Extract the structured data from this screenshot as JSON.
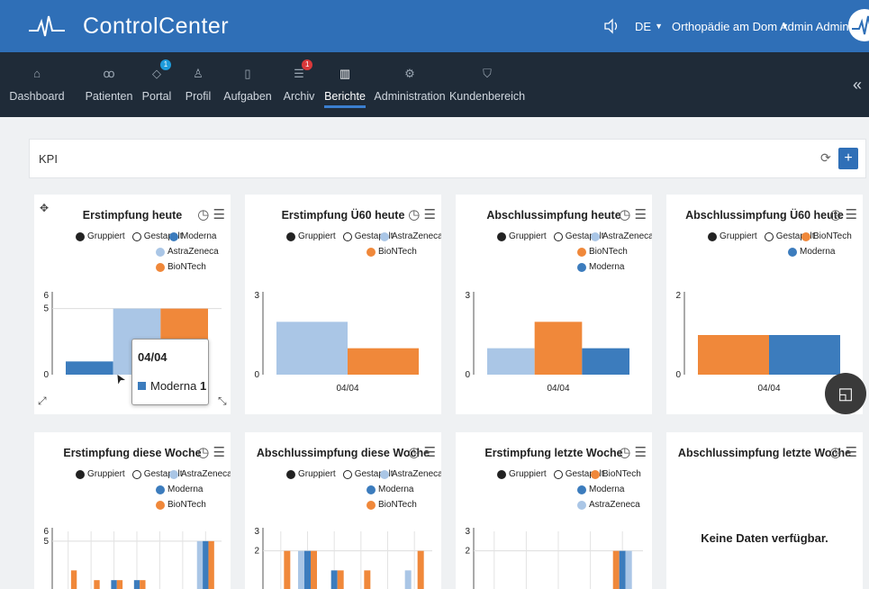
{
  "app": {
    "brand": "ControlCenter"
  },
  "topbar": {
    "language": "DE",
    "clinic": "Orthopädie am Dom",
    "user": "Admin Admin"
  },
  "nav": {
    "items": [
      {
        "label": "Dashboard",
        "icon": "home-icon"
      },
      {
        "label": "Patienten",
        "icon": "patients-icon"
      },
      {
        "label": "Portal",
        "icon": "portal-icon",
        "badge": "1"
      },
      {
        "label": "Profil",
        "icon": "profile-icon"
      },
      {
        "label": "Aufgaben",
        "icon": "tasks-icon"
      },
      {
        "label": "Archiv",
        "icon": "archive-icon",
        "badge": "1"
      },
      {
        "label": "Berichte",
        "icon": "reports-icon",
        "active": true
      },
      {
        "label": "Administration",
        "icon": "gear-icon"
      },
      {
        "label": "Kundenbereich",
        "icon": "cart-icon"
      }
    ]
  },
  "kpi": {
    "label": "KPI"
  },
  "legend_common": {
    "grouped": "Gruppiert",
    "stacked": "Gestapelt"
  },
  "colors": {
    "moderna": "#3c7cbd",
    "astrazeneca": "#aac6e6",
    "biontech": "#f0883a"
  },
  "cards": [
    {
      "title": "Erstimpfung heute",
      "legend": [
        "Moderna",
        "AstraZeneca",
        "BioNTech"
      ],
      "stacked_label": "Gestapelt",
      "tooltip": {
        "date": "04/04",
        "series": "Moderna",
        "value": "1"
      }
    },
    {
      "title": "Erstimpfung Ü60 heute",
      "legend": [
        "AstraZeneca",
        "BioNTech"
      ],
      "stacked_label": "Gestapelt",
      "xlabel": "04/04"
    },
    {
      "title": "Abschlussimpfung heute",
      "legend": [
        "AstraZeneca",
        "BioNTech",
        "Moderna"
      ],
      "stacked_label": "Gestapelt",
      "xlabel": "04/04"
    },
    {
      "title": "Abschlussimpfung Ü60 heute",
      "legend": [
        "BioNTech",
        "Moderna"
      ],
      "stacked_label": "Gestapelt",
      "xlabel": "04/04"
    },
    {
      "title": "Erstimpfung diese Woche",
      "legend": [
        "AstraZeneca",
        "Moderna",
        "BioNTech"
      ],
      "stacked_label": "Gestapelt"
    },
    {
      "title": "Abschlussimpfung diese Woche",
      "legend": [
        "AstraZeneca",
        "Moderna",
        "BioNTech"
      ],
      "stacked_label": "Gestapelt"
    },
    {
      "title": "Erstimpfung letzte Woche",
      "legend": [
        "BioNTech",
        "Moderna",
        "AstraZeneca"
      ],
      "stacked_label": "Gestapelt"
    },
    {
      "title": "Abschlussimpfung letzte Woche",
      "nodata": "Keine Daten verfügbar."
    }
  ],
  "chart_data": [
    {
      "type": "bar",
      "title": "Erstimpfung heute",
      "categories": [
        "04/04"
      ],
      "ylim": [
        0,
        6
      ],
      "yticks": [
        "0",
        "5",
        "6"
      ],
      "series": [
        {
          "name": "Moderna",
          "values": [
            1
          ]
        },
        {
          "name": "AstraZeneca",
          "values": [
            5
          ]
        },
        {
          "name": "BioNTech",
          "values": [
            5
          ]
        }
      ]
    },
    {
      "type": "bar",
      "title": "Erstimpfung Ü60 heute",
      "categories": [
        "04/04"
      ],
      "ylim": [
        0,
        3
      ],
      "yticks": [
        "0",
        "3"
      ],
      "series": [
        {
          "name": "AstraZeneca",
          "values": [
            2
          ]
        },
        {
          "name": "BioNTech",
          "values": [
            1
          ]
        }
      ]
    },
    {
      "type": "bar",
      "title": "Abschlussimpfung heute",
      "categories": [
        "04/04"
      ],
      "ylim": [
        0,
        3
      ],
      "yticks": [
        "0",
        "3"
      ],
      "series": [
        {
          "name": "AstraZeneca",
          "values": [
            1
          ]
        },
        {
          "name": "BioNTech",
          "values": [
            2
          ]
        },
        {
          "name": "Moderna",
          "values": [
            1
          ]
        }
      ]
    },
    {
      "type": "bar",
      "title": "Abschlussimpfung Ü60 heute",
      "categories": [
        "04/04"
      ],
      "ylim": [
        0,
        2
      ],
      "yticks": [
        "0",
        "2"
      ],
      "series": [
        {
          "name": "BioNTech",
          "values": [
            1
          ]
        },
        {
          "name": "Moderna",
          "values": [
            1
          ]
        }
      ]
    },
    {
      "type": "bar",
      "title": "Erstimpfung diese Woche",
      "ylim": [
        0,
        6
      ],
      "yticks": [
        "5",
        "6"
      ],
      "series": [
        {
          "name": "AstraZeneca",
          "values": [
            0,
            0,
            0,
            0,
            0,
            0,
            5
          ]
        },
        {
          "name": "Moderna",
          "values": [
            0,
            0,
            1,
            1,
            0,
            0,
            5
          ]
        },
        {
          "name": "BioNTech",
          "values": [
            2,
            1,
            1,
            1,
            0,
            0,
            5
          ]
        }
      ]
    },
    {
      "type": "bar",
      "title": "Abschlussimpfung diese Woche",
      "ylim": [
        0,
        3
      ],
      "yticks": [
        "2",
        "3"
      ],
      "series": [
        {
          "name": "AstraZeneca",
          "values": [
            0,
            2,
            0,
            0,
            0,
            1
          ]
        },
        {
          "name": "Moderna",
          "values": [
            0,
            2,
            1,
            0,
            0,
            0
          ]
        },
        {
          "name": "BioNTech",
          "values": [
            2,
            2,
            1,
            1,
            0,
            2
          ]
        }
      ]
    },
    {
      "type": "bar",
      "title": "Erstimpfung letzte Woche",
      "ylim": [
        0,
        3
      ],
      "yticks": [
        "2",
        "3"
      ],
      "series": [
        {
          "name": "BioNTech",
          "values": [
            0,
            0,
            0,
            0,
            2
          ]
        },
        {
          "name": "Moderna",
          "values": [
            0,
            0,
            0,
            0,
            2
          ]
        },
        {
          "name": "AstraZeneca",
          "values": [
            0,
            0,
            0,
            0,
            2
          ]
        }
      ]
    }
  ]
}
